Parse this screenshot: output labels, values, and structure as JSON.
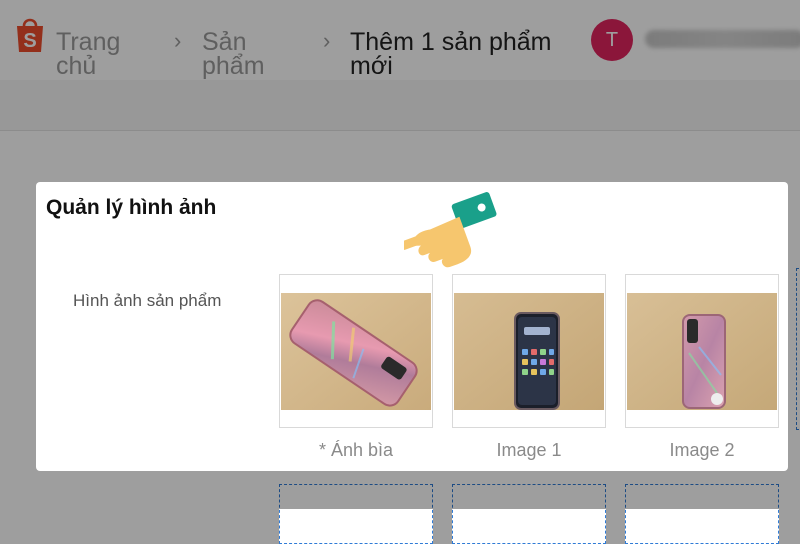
{
  "header": {
    "breadcrumbs": [
      {
        "line1": "Trang",
        "line2": "chủ"
      },
      {
        "line1": "Sản",
        "line2": "phẩm"
      },
      {
        "line1": "Thêm 1 sản phẩm",
        "line2": "mới"
      }
    ],
    "avatar_initial": "T"
  },
  "modal": {
    "title": "Quản lý hình ảnh",
    "field_label": "Hình ảnh sản phẩm",
    "images": [
      {
        "caption": "* Ánh bìa"
      },
      {
        "caption": "Image 1"
      },
      {
        "caption": "Image 2"
      }
    ]
  },
  "colors": {
    "brand": "#ee4d2d",
    "avatar": "#e0245e",
    "dashed_border": "#2f7bd6"
  }
}
